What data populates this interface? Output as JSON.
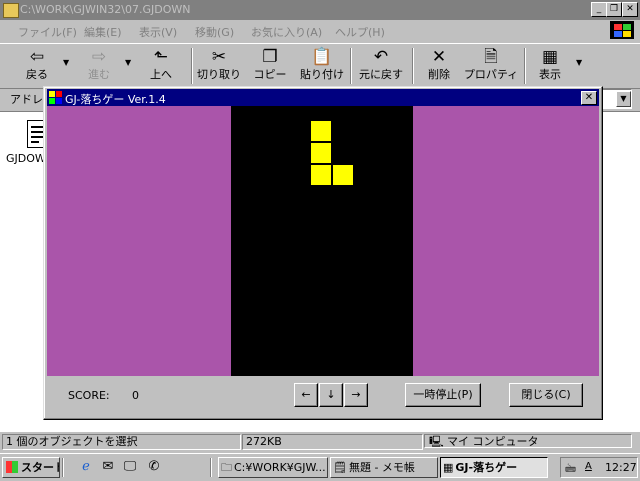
{
  "explorer": {
    "title": "C:\\WORK\\GJWIN32\\07.GJDOWN",
    "menu": [
      "ファイル(F)",
      "編集(E)",
      "表示(V)",
      "移動(G)",
      "お気に入り(A)",
      "ヘルプ(H)"
    ],
    "toolbar": {
      "back": "戻る",
      "forward": "進む",
      "up": "上へ",
      "cut": "切り取り",
      "copy": "コピー",
      "paste": "貼り付け",
      "undo": "元に戻す",
      "delete": "削除",
      "properties": "プロパティ",
      "view": "表示"
    },
    "address_label": "アドレス",
    "file_label": "GJDOW",
    "status": {
      "selection": "1 個のオブジェクトを選択",
      "size": "272KB",
      "location": "マイ コンピュータ"
    }
  },
  "game": {
    "title": "GJ-落ちゲー  Ver.1.4",
    "score_label": "SCORE:",
    "score_value": "0",
    "btn_left": "←",
    "btn_down": "↓",
    "btn_right": "→",
    "btn_pause": "一時停止(P)",
    "btn_close": "閉じる(C)",
    "piece": [
      [
        0,
        0
      ],
      [
        0,
        1
      ],
      [
        0,
        2
      ],
      [
        1,
        2
      ]
    ],
    "colors": {
      "background": "#aa55aa",
      "well": "#000000",
      "block": "#ffff00"
    }
  },
  "taskbar": {
    "start": "スタート",
    "items": [
      "C:¥WORK¥GJW...",
      "無題 - メモ帳",
      "GJ-落ちゲー"
    ],
    "clock": "12:27",
    "ime": "A"
  }
}
